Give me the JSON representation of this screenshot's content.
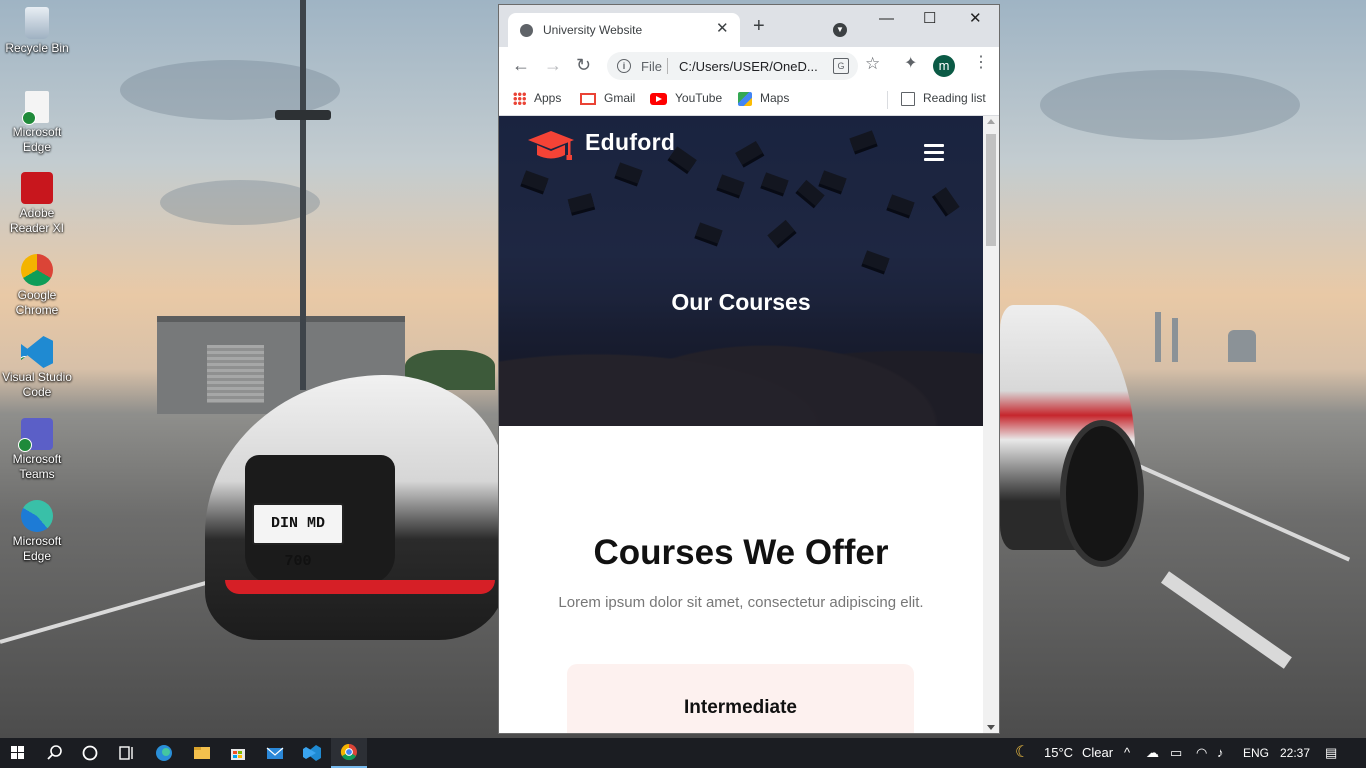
{
  "desktop_icons": [
    {
      "label": "Recycle Bin",
      "icon": "recycle-bin-icon"
    },
    {
      "label": "Microsoft Edge",
      "icon": "edge-shortcut-icon"
    },
    {
      "label": "Adobe Reader XI",
      "icon": "adobe-reader-icon"
    },
    {
      "label": "Google Chrome",
      "icon": "chrome-icon"
    },
    {
      "label": "Visual Studio Code",
      "icon": "vscode-icon"
    },
    {
      "label": "Microsoft Teams",
      "icon": "teams-icon"
    },
    {
      "label": "Microsoft Edge",
      "icon": "edge-icon"
    }
  ],
  "wallpaper": {
    "plate_text": "DIN MD 700"
  },
  "browser": {
    "tab_title": "University Website",
    "tab_close": "✕",
    "new_tab": "+",
    "window": {
      "minimize": "—",
      "maximize": "☐",
      "close": "✕"
    },
    "omnibox": {
      "scheme_label": "File",
      "url": "C:/Users/USER/OneD..."
    },
    "profile_initial": "m",
    "bookmarks": [
      {
        "label": "Apps",
        "icon": "apps-grid-icon"
      },
      {
        "label": "Gmail",
        "icon": "gmail-icon"
      },
      {
        "label": "YouTube",
        "icon": "youtube-icon"
      },
      {
        "label": "Maps",
        "icon": "maps-icon"
      }
    ],
    "reading_list": "Reading list"
  },
  "page": {
    "brand": "Eduford",
    "hero_title": "Our Courses",
    "section_title": "Courses We Offer",
    "section_subtitle": "Lorem ipsum dolor sit amet, consectetur adipiscing elit.",
    "card_title": "Intermediate",
    "accent_color": "#f44336"
  },
  "taskbar": {
    "weather_temp": "15°C",
    "weather_text": "Clear",
    "language": "ENG",
    "time": "22:37"
  }
}
